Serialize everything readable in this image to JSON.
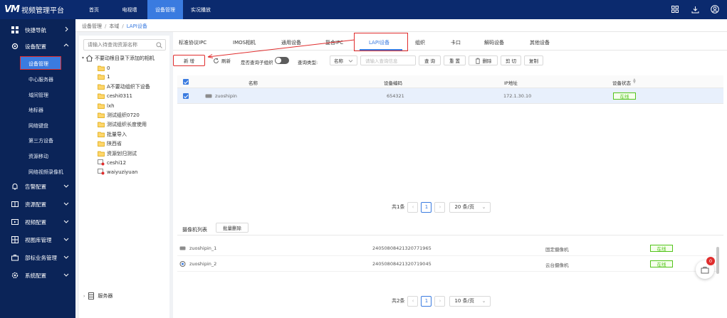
{
  "app": {
    "logo_mark": "VM",
    "title": "视频管理平台"
  },
  "topnav": [
    "首页",
    "电视墙",
    "设备管理",
    "实况播放"
  ],
  "sidebar": {
    "groups": [
      {
        "label": "快捷导航"
      },
      {
        "label": "设备配置"
      },
      {
        "label": "告警配置"
      },
      {
        "label": "资源配置"
      },
      {
        "label": "视频配置"
      },
      {
        "label": "视图库管理"
      },
      {
        "label": "部标业务管理"
      },
      {
        "label": "系统配置"
      }
    ],
    "subitems": [
      "设备管理",
      "中心服务器",
      "域间管理",
      "地标器",
      "网络键盘",
      "第三方设备",
      "资源移动",
      "网络视频录像机"
    ]
  },
  "breadcrumb": {
    "items": [
      "设备管理",
      "本域",
      "LAPI设备"
    ],
    "sep": "/"
  },
  "tree": {
    "search_placeholder": "请输入待查询资源名称",
    "root": "不要动根目录下添加的相机",
    "items": [
      "0",
      "1",
      "A不要动组织下设备",
      "ceshi0311",
      "lxh",
      "测试组织0720",
      "测试组织长度使用",
      "批量导入",
      "陕西省",
      "资源划归测试"
    ],
    "devices": [
      "ceshi12",
      "waiyuziyuan"
    ],
    "footer": "服务器"
  },
  "tabs": [
    "标准协议IPC",
    "IMOS相机",
    "通用设备",
    "复合IPC",
    "LAPI设备",
    "组织",
    "卡口",
    "解码设备",
    "其他设备"
  ],
  "toolbar": {
    "new": "新 增",
    "refresh": "刷新",
    "include_sub": "是否查询子组织",
    "query_type_label": "查询类型:",
    "query_type_value": "名称",
    "search_placeholder": "请输入查询信息",
    "query": "查 询",
    "reset": "重 置",
    "delete": "删除",
    "cut": "剪 切",
    "copy": "复制"
  },
  "device_table": {
    "headers": [
      "名称",
      "设备编码",
      "IP地址",
      "设备状态"
    ],
    "rows": [
      {
        "name": "zuoshipin",
        "code": "654321",
        "ip": "172.1.30.10",
        "status": "在线"
      }
    ]
  },
  "pager1": {
    "total": "共1条",
    "page": "1",
    "size": "20 条/页"
  },
  "camera_list": {
    "title": "摄像机列表",
    "batch_delete": "批量删除",
    "rows": [
      {
        "name": "zuoshipin_1",
        "code": "24050808421320771965",
        "type": "固定摄像机",
        "status": "在线"
      },
      {
        "name": "zuoshipin_2",
        "code": "24050808421320719045",
        "type": "云台摄像机",
        "status": "在线"
      }
    ]
  },
  "pager2": {
    "total": "共2条",
    "page": "1",
    "size": "10 条/页"
  },
  "float_badge": "0",
  "colors": {
    "topbar": "#0b2a6e",
    "sidebar": "#0b2458",
    "accent": "#3a7be0",
    "highlight": "#e02d2d",
    "online": "#52c41a"
  }
}
